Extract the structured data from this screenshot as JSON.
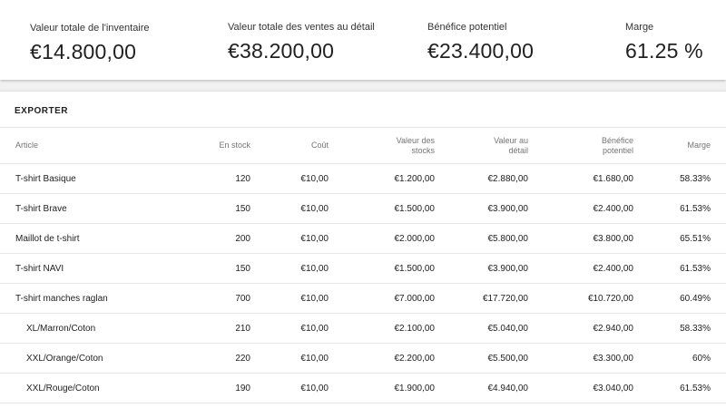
{
  "summary": [
    {
      "label": "Valeur totale de l'inventaire",
      "value": "€14.800,00"
    },
    {
      "label": "Valeur totale des ventes au détail",
      "value": "€38.200,00"
    },
    {
      "label": "Bénéfice potentiel",
      "value": "€23.400,00"
    },
    {
      "label": "Marge",
      "value": "61.25 %"
    }
  ],
  "export_label": "EXPORTER",
  "table": {
    "columns": [
      {
        "line1": "Article",
        "line2": ""
      },
      {
        "line1": "En stock",
        "line2": ""
      },
      {
        "line1": "Coût",
        "line2": ""
      },
      {
        "line1": "Valeur des",
        "line2": "stocks"
      },
      {
        "line1": "Valeur au",
        "line2": "détail"
      },
      {
        "line1": "Bénéfice",
        "line2": "potentiel"
      },
      {
        "line1": "Marge",
        "line2": ""
      }
    ],
    "rows": [
      {
        "article": "T-shirt Basique",
        "stock": "120",
        "cost": "€10,00",
        "stock_value": "€1.200,00",
        "retail_value": "€2.880,00",
        "profit": "€1.680,00",
        "margin": "58.33%"
      },
      {
        "article": "T-shirt Brave",
        "stock": "150",
        "cost": "€10,00",
        "stock_value": "€1.500,00",
        "retail_value": "€3.900,00",
        "profit": "€2.400,00",
        "margin": "61.53%"
      },
      {
        "article": "Maillot de t-shirt",
        "stock": "200",
        "cost": "€10,00",
        "stock_value": "€2.000,00",
        "retail_value": "€5.800,00",
        "profit": "€3.800,00",
        "margin": "65.51%"
      },
      {
        "article": "T-shirt NAVI",
        "stock": "150",
        "cost": "€10,00",
        "stock_value": "€1.500,00",
        "retail_value": "€3.900,00",
        "profit": "€2.400,00",
        "margin": "61.53%"
      },
      {
        "article": "T-shirt manches raglan",
        "stock": "700",
        "cost": "€10,00",
        "stock_value": "€7.000,00",
        "retail_value": "€17.720,00",
        "profit": "€10.720,00",
        "margin": "60.49%"
      },
      {
        "article": "XL/Marron/Coton",
        "stock": "210",
        "cost": "€10,00",
        "stock_value": "€2.100,00",
        "retail_value": "€5.040,00",
        "profit": "€2.940,00",
        "margin": "58.33%"
      },
      {
        "article": "XXL/Orange/Coton",
        "stock": "220",
        "cost": "€10,00",
        "stock_value": "€2.200,00",
        "retail_value": "€5.500,00",
        "profit": "€3.300,00",
        "margin": "60%"
      },
      {
        "article": "XXL/Rouge/Coton",
        "stock": "190",
        "cost": "€10,00",
        "stock_value": "€1.900,00",
        "retail_value": "€4.940,00",
        "profit": "€3.040,00",
        "margin": "61.53%"
      }
    ]
  }
}
